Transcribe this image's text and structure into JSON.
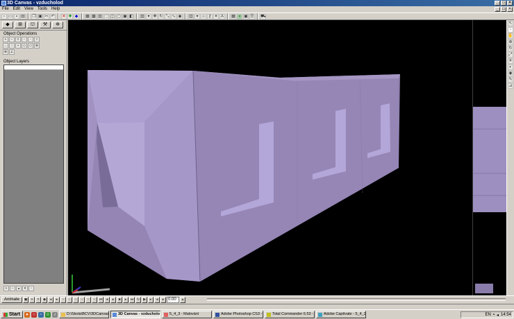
{
  "window": {
    "title": "3D Canvas - vzducholod"
  },
  "menu": [
    "File",
    "Edit",
    "View",
    "Tools",
    "Help"
  ],
  "left_panel": {
    "object_operations_label": "Object Operations",
    "object_layers_label": "Object Layers"
  },
  "animation_bar": {
    "animate_label": "Animate",
    "time_value": "0.00"
  },
  "taskbar": {
    "start_label": "Start",
    "tasks": [
      "D:\\Skola\\BCV\\3DCanvas\\",
      "3D Canvas - vzducholod",
      "5_4_3 - Malování",
      "Adobe Photoshop CS3 - [",
      "Total Commander 6.53 - F",
      "Adobe Captivate - 5_4_2"
    ],
    "active_task_index": 1,
    "language": "EN",
    "clock": "14:54"
  },
  "colors": {
    "viewport_bg": "#000000",
    "model_face_light": "#a99bcb",
    "model_face_mid": "#9283b3",
    "model_face_dark": "#7d6f9e",
    "titlebar": "#0a246a"
  }
}
